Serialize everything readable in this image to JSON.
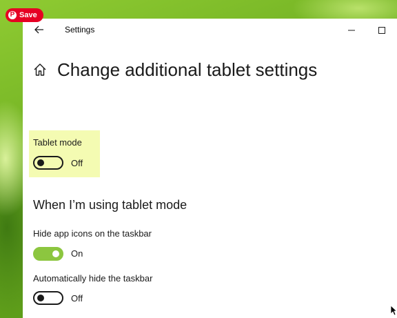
{
  "pin": {
    "label": "Save",
    "icon": "P"
  },
  "window": {
    "title": "Settings"
  },
  "page": {
    "title": "Change additional tablet settings"
  },
  "tablet_mode": {
    "label": "Tablet mode",
    "state": "Off",
    "on": false
  },
  "section": {
    "heading": "When I’m using tablet mode"
  },
  "hide_icons": {
    "label": "Hide app icons on the taskbar",
    "state": "On",
    "on": true
  },
  "auto_hide": {
    "label": "Automatically hide the taskbar",
    "state": "Off",
    "on": false
  },
  "colors": {
    "accent": "#8cc63f",
    "highlight": "#f4fbb2",
    "pin": "#e60023"
  }
}
